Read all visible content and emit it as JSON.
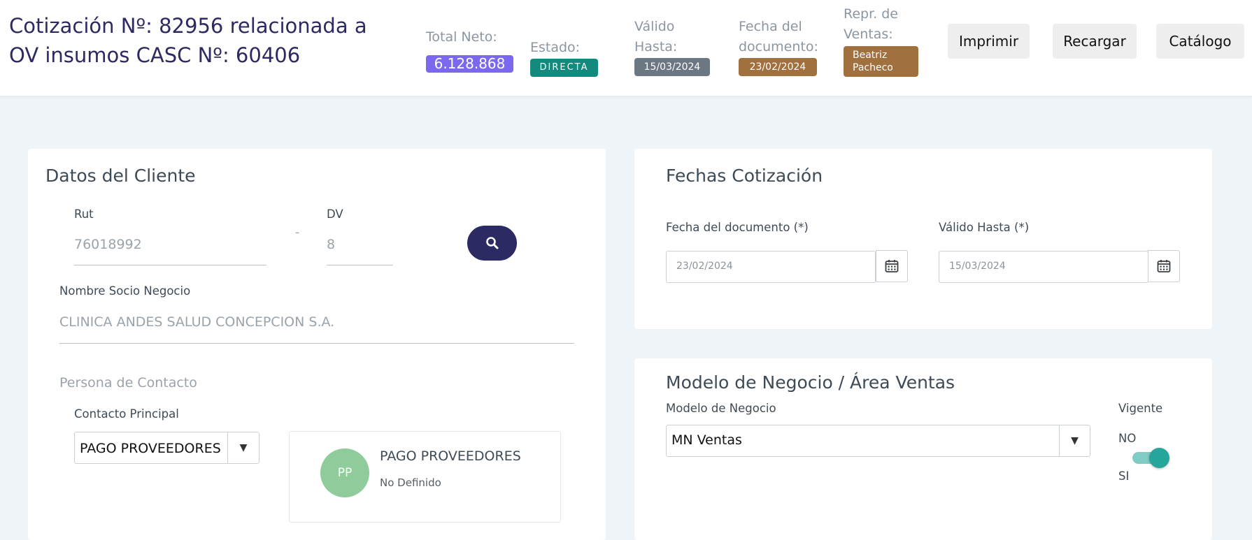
{
  "header": {
    "title": "Cotización Nº: 82956 relacionada a OV insumos CASC Nº: 60406",
    "total_neto_label": "Total Neto:",
    "total_neto_value": "6.128.868",
    "estado_label": "Estado:",
    "estado_value": "DIRECTA",
    "valido_hasta_label": "Válido Hasta:",
    "valido_hasta_value": "15/03/2024",
    "fecha_doc_label": "Fecha del documento:",
    "fecha_doc_value": "23/02/2024",
    "repr_label": "Repr. de Ventas:",
    "repr_value": "Beatriz Pacheco",
    "buttons": {
      "imprimir": "Imprimir",
      "recargar": "Recargar",
      "catalogo": "Catálogo"
    }
  },
  "cliente": {
    "title": "Datos del Cliente",
    "rut_label": "Rut",
    "rut_value": "76018992",
    "separator": "-",
    "dv_label": "DV",
    "dv_value": "8",
    "nombre_label": "Nombre Socio Negocio",
    "nombre_value": "CLINICA ANDES SALUD CONCEPCION S.A.",
    "contacto_section": "Persona de Contacto",
    "contacto_principal_label": "Contacto Principal",
    "contacto_principal_value": "PAGO PROVEEDORES",
    "contact_card": {
      "initials": "PP",
      "name": "PAGO PROVEEDORES",
      "detail": "No Definido"
    }
  },
  "fechas": {
    "title": "Fechas Cotización",
    "fecha_doc_label": "Fecha del documento (*)",
    "fecha_doc_value": "23/02/2024",
    "valido_label": "Válido Hasta (*)",
    "valido_value": "15/03/2024"
  },
  "modelo": {
    "title": "Modelo de Negocio / Área Ventas",
    "modelo_label": "Modelo de Negocio",
    "modelo_value": "MN Ventas",
    "vigente_label": "Vigente",
    "no_label": "NO",
    "si_label": "SI"
  },
  "colors": {
    "title_color": "#2c2a63",
    "total_badge": "#7b68ee",
    "estado_badge": "#14897d",
    "valido_badge": "#6b7883",
    "fecha_badge": "#a0703f",
    "repr_badge": "#a0703f",
    "search_button": "#2c2a63",
    "toggle": "#26a69a",
    "avatar": "#8fcb9b"
  },
  "icons": {
    "search": "search-icon",
    "calendar": "calendar-icon",
    "dropdown": "chevron-down-icon"
  }
}
